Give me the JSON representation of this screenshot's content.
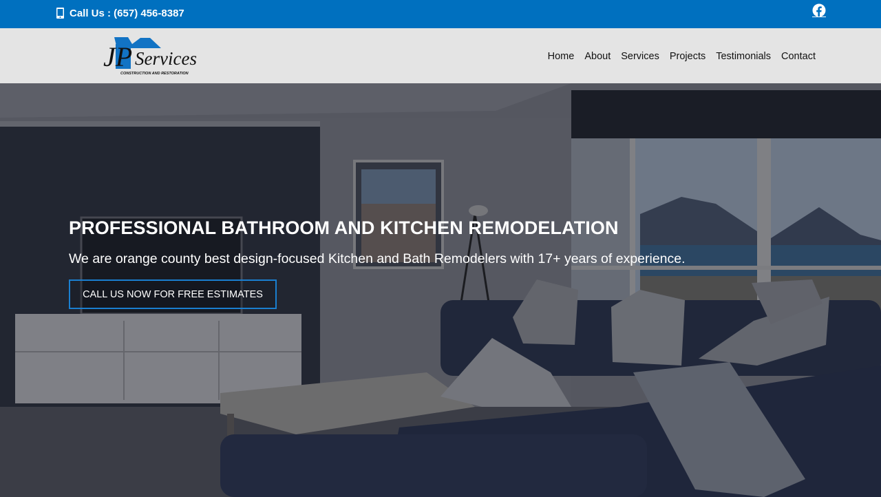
{
  "topbar": {
    "call_text": "Call Us : (657) 456-8387",
    "icons": [
      "phone-icon",
      "facebook-icon"
    ],
    "bg_color": "#0070bf"
  },
  "header": {
    "logo_initials": "JP",
    "logo_name": "Services",
    "logo_tagline": "CONSTRUCTION AND RESTORATION",
    "nav": [
      "Home",
      "About",
      "Services",
      "Projects",
      "Testimonials",
      "Contact"
    ]
  },
  "hero": {
    "title": "PROFESSIONAL BATHROOM AND KITCHEN REMODELATION",
    "subtitle": "We are orange county best design-focused Kitchen and Bath Remodelers with 17+ years of experience.",
    "cta_label": "CALL US NOW FOR FREE ESTIMATES",
    "accent_color": "#1a7fd0"
  }
}
